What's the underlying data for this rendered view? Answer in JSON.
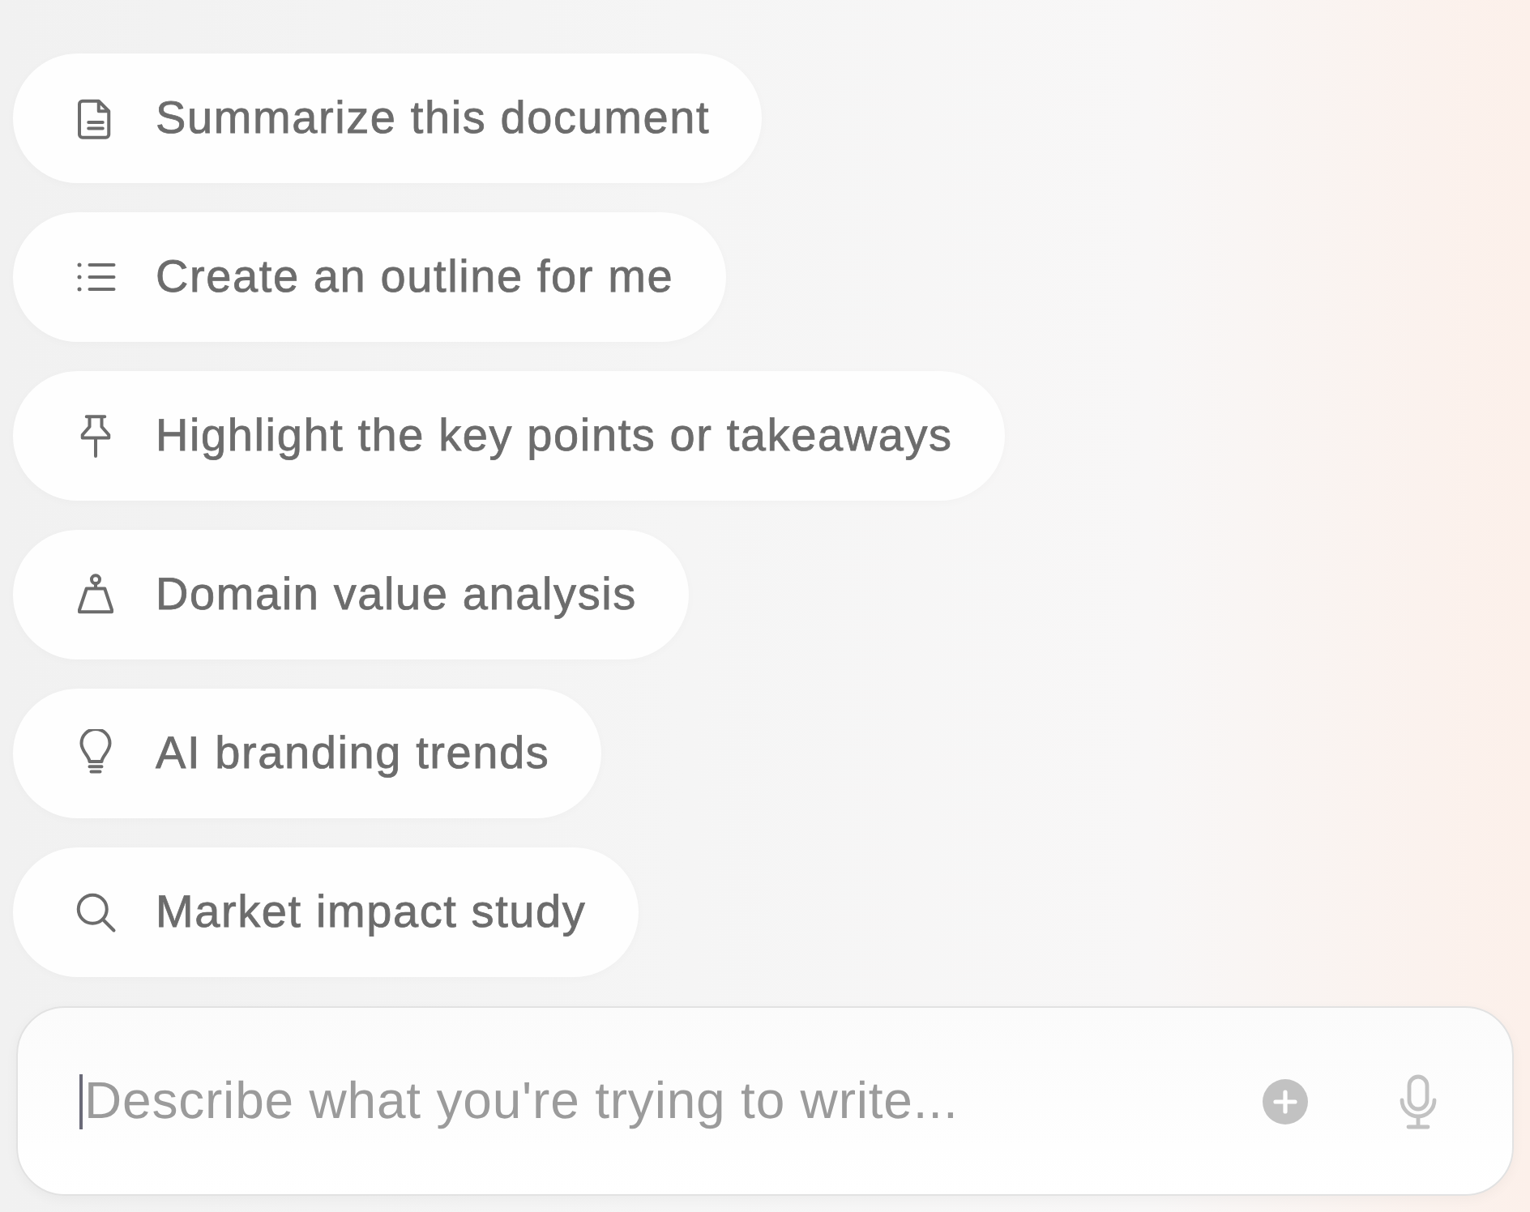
{
  "suggestions": [
    {
      "kind": "document",
      "label": "Summarize this document"
    },
    {
      "kind": "list",
      "label": "Create an outline for me"
    },
    {
      "kind": "pin",
      "label": "Highlight the key points or takeaways"
    },
    {
      "kind": "weight",
      "label": "Domain value analysis"
    },
    {
      "kind": "bulb",
      "label": "AI branding trends"
    },
    {
      "kind": "search",
      "label": "Market impact study"
    }
  ],
  "composer": {
    "placeholder": "Describe what you're trying to write...",
    "focused": true
  }
}
